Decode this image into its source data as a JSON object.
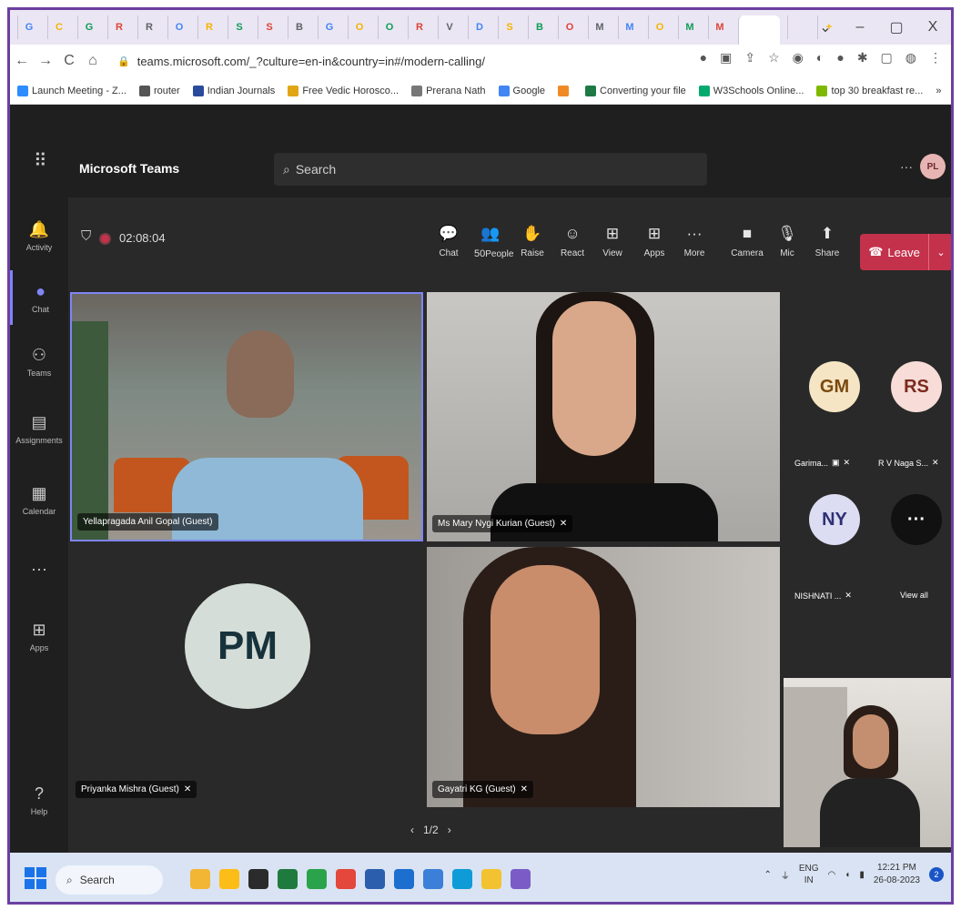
{
  "browser": {
    "tabs": [
      "G",
      "C",
      "G",
      "R",
      "R",
      "O",
      "R",
      "S",
      "S",
      "B",
      "G",
      "O",
      "O",
      "R",
      "V",
      "D",
      "S",
      "B",
      "O",
      "M",
      "M",
      "O",
      "M",
      "M",
      "",
      "",
      "+"
    ],
    "active_tab_close": "×",
    "new_tab": "+",
    "window_controls": {
      "chevron": "⌄",
      "minimize": "–",
      "restore": "▢",
      "close": "X"
    },
    "nav": {
      "back": "←",
      "forward": "→",
      "reload": "C",
      "home": "⌂"
    },
    "url": "teams.microsoft.com/_?culture=en-in&country=in#/modern-calling/"
  },
  "bookmarks": [
    {
      "label": "Launch Meeting - Z...",
      "color": "#2d8cff"
    },
    {
      "label": "router",
      "color": "#555555"
    },
    {
      "label": "Indian Journals",
      "color": "#2a4b9b"
    },
    {
      "label": "Free Vedic Horosco...",
      "color": "#e2a516"
    },
    {
      "label": "Prerana Nath",
      "color": "#777777"
    },
    {
      "label": "Google",
      "color": "#4285f4"
    },
    {
      "label": "",
      "color": "#f08a24"
    },
    {
      "label": "Converting your file",
      "color": "#1e7a45"
    },
    {
      "label": "W3Schools Online...",
      "color": "#04aa6d"
    },
    {
      "label": "top 30 breakfast re...",
      "color": "#7fb800"
    }
  ],
  "bookmarks_overflow": "»",
  "teams": {
    "app_title": "Microsoft Teams",
    "search_placeholder": "Search",
    "header_more": "···",
    "user_initials": "PL"
  },
  "rail": [
    {
      "label": "Activity",
      "icon": "bell-icon"
    },
    {
      "label": "Chat",
      "icon": "chat-icon"
    },
    {
      "label": "Teams",
      "icon": "teams-icon"
    },
    {
      "label": "Assignments",
      "icon": "assignments-icon"
    },
    {
      "label": "Calendar",
      "icon": "calendar-icon"
    },
    {
      "label": "",
      "icon": "more-icon"
    },
    {
      "label": "Apps",
      "icon": "apps-icon"
    },
    {
      "label": "Help",
      "icon": "help-icon"
    }
  ],
  "meeting": {
    "timer": "02:08:04",
    "toolbar": [
      {
        "label": "Chat",
        "glyph": "💬"
      },
      {
        "label": "People",
        "glyph": "👥",
        "count": "50"
      },
      {
        "label": "Raise",
        "glyph": "✋"
      },
      {
        "label": "React",
        "glyph": "☺"
      },
      {
        "label": "View",
        "glyph": "⊞"
      },
      {
        "label": "Apps",
        "glyph": "⊞"
      },
      {
        "label": "More",
        "glyph": "···"
      },
      {
        "label": "Camera",
        "glyph": "■"
      },
      {
        "label": "Mic",
        "glyph": "🎙"
      },
      {
        "label": "Share",
        "glyph": "⬆"
      }
    ],
    "leave_label": "Leave",
    "leave_chevron": "⌄"
  },
  "participants": [
    {
      "name": "Yellapragada Anil Gopal (Guest)"
    },
    {
      "name": "Ms Mary Nygi Kurian (Guest)"
    },
    {
      "name": "Priyanka Mishra (Guest)",
      "initials": "PM"
    },
    {
      "name": "Gayatri KG (Guest)"
    }
  ],
  "roster": [
    {
      "initials": "GM",
      "name": "Garima...",
      "bg": "#f6e5c4",
      "fg": "#7a4a10"
    },
    {
      "initials": "RS",
      "name": "R V Naga S...",
      "bg": "#f7dcd7",
      "fg": "#7a2a1e"
    },
    {
      "initials": "NY",
      "name": "NISHNATI ...",
      "bg": "#dcdcf2",
      "fg": "#2f2f75"
    },
    {
      "initials": "···",
      "name": "View all",
      "bg": "#111111",
      "fg": "#ffffff"
    }
  ],
  "pager": {
    "prev": "‹",
    "label": "1/2",
    "next": "›"
  },
  "taskbar": {
    "search_label": "Search",
    "apps": [
      "#f2b634",
      "#fdbd18",
      "#2b2b2b",
      "#1f7a3d",
      "#2aa34a",
      "#e4473b",
      "#2b5fae",
      "#1d6fcf",
      "#3b7fd9",
      "#0f9bd7",
      "#f2c230",
      "#7b5cc6"
    ],
    "lang_top": "ENG",
    "lang_bottom": "IN",
    "time": "12:21 PM",
    "date": "26-08-2023",
    "notifications": "2"
  }
}
